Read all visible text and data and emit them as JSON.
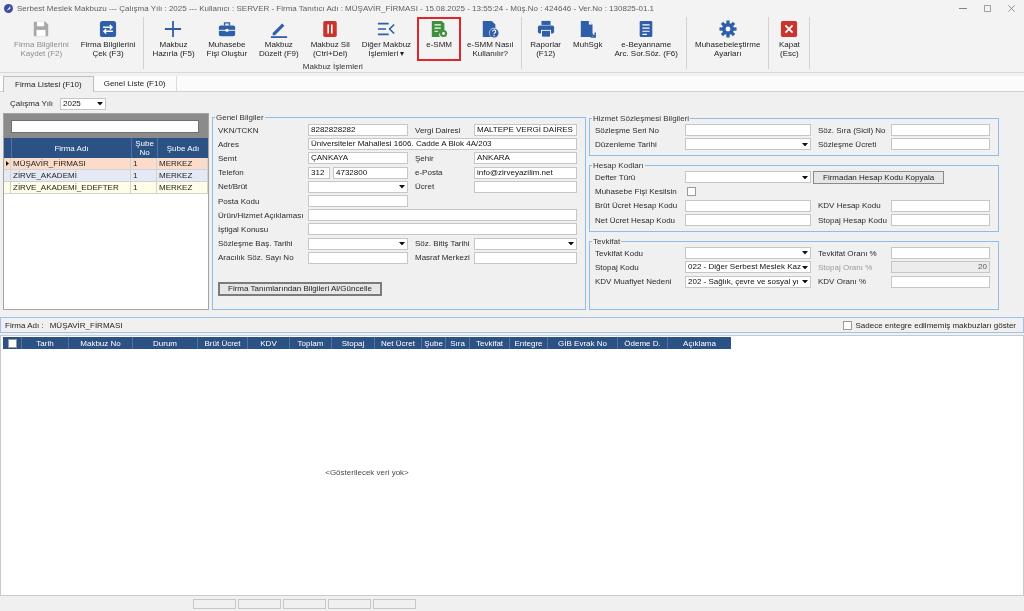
{
  "window": {
    "title": "Serbest Meslek Makbuzu --- Çalışma Yılı : 2025 --- Kullanıcı : SERVER - Firma Tanıtıcı Adı : MÜŞAVİR_FİRMASI - 15.08.2025 - 13:55:24 - Müş.No : 424646 - Ver.No : 130825-01.1"
  },
  "toolbar": {
    "groups": [
      {
        "buttons": [
          {
            "label": "Firma Bilgilerini\nKaydet (F2)",
            "disabled": true,
            "highlighted": false
          },
          {
            "label": "Firma Bilgilerini\nÇek (F3)",
            "disabled": false,
            "highlighted": false
          }
        ]
      },
      {
        "label": "Makbuz İşlemleri",
        "buttons": [
          {
            "label": "Makbuz\nHazırla (F5)",
            "disabled": false,
            "highlighted": false
          },
          {
            "label": "Muhasebe\nFişi Oluştur",
            "disabled": false,
            "highlighted": false
          },
          {
            "label": "Makbuz\nDüzelt (F9)",
            "disabled": false,
            "highlighted": false
          },
          {
            "label": "Makbuz Sil\n(Ctrl+Del)",
            "disabled": false,
            "highlighted": false
          },
          {
            "label": "Diğer Makbuz\nİşlemleri ▾",
            "disabled": false,
            "highlighted": false
          },
          {
            "label": "e-SMM",
            "disabled": false,
            "highlighted": true
          },
          {
            "label": "e-SMM Nasıl\nKullanılır?",
            "disabled": false,
            "highlighted": false
          }
        ]
      },
      {
        "buttons": [
          {
            "label": "Raporlar\n(F12)",
            "disabled": false,
            "highlighted": false
          },
          {
            "label": "MuhSgk",
            "disabled": false,
            "highlighted": false
          },
          {
            "label": "e-Beyanname\nArc. Sor.Söz. (F6)",
            "disabled": false,
            "highlighted": false
          }
        ]
      },
      {
        "buttons": [
          {
            "label": "Muhasebeleştirme\nAyarları",
            "disabled": false,
            "highlighted": false
          }
        ]
      },
      {
        "buttons": [
          {
            "label": "Kapat\n(Esc)",
            "disabled": false,
            "highlighted": false
          }
        ]
      }
    ]
  },
  "tabs": [
    {
      "label": "Firma Listesi (F10)",
      "selected": true
    },
    {
      "label": "Genel Liste (F10)",
      "selected": false
    }
  ],
  "year_filter": {
    "label": "Çalışma Yılı",
    "value": "2025"
  },
  "firm_list": {
    "columns": [
      "Firma Adı",
      "Şube\nNo",
      "Şube Adı"
    ],
    "rows": [
      {
        "cells": [
          "MÜŞAVİR_FİRMASI",
          "1",
          "MERKEZ"
        ],
        "selected": true,
        "color": "#fbdccb"
      },
      {
        "cells": [
          "ZİRVE_AKADEMİ",
          "1",
          "MERKEZ"
        ],
        "selected": false,
        "color": "#e4e9f5"
      },
      {
        "cells": [
          "ZİRVE_AKADEMİ_EDEFTER",
          "1",
          "MERKEZ"
        ],
        "selected": false,
        "color": "#fefde6"
      }
    ]
  },
  "general_info": {
    "title": "Genel Bilgiler",
    "rows": [
      [
        {
          "label": "VKN/TCKN",
          "kind": "text",
          "value": "8282828282"
        },
        {
          "label": "Vergi Dairesi",
          "kind": "text",
          "value": "MALTEPE VERGİ DAİRES"
        }
      ],
      [
        {
          "label": "Adres",
          "kind": "wide",
          "value": "Üniversiteler Mahallesi 1606. Cadde A Blok 4A/203"
        }
      ],
      [
        {
          "label": "Semt",
          "kind": "text",
          "value": "ÇANKAYA"
        },
        {
          "label": "Şehir",
          "kind": "text",
          "value": "ANKARA"
        }
      ],
      [
        {
          "label": "Telefon",
          "kind": "phone",
          "area_code": "312",
          "value": "4732800"
        },
        {
          "label": "e-Posta",
          "kind": "text",
          "value": "info@zirveyazilim.net"
        }
      ],
      [
        {
          "label": "Net/Brüt",
          "kind": "select"
        },
        {
          "label": "Ücret",
          "kind": "text"
        }
      ],
      [
        {
          "label": "Posta Kodu",
          "kind": "text"
        }
      ],
      [
        {
          "label": "Ürün/Hizmet Açıklaması",
          "kind": "wide"
        }
      ],
      [
        {
          "label": "İştigal Konusu",
          "kind": "wide"
        }
      ],
      [
        {
          "label": "Sözleşme Baş. Tarihi",
          "kind": "select"
        },
        {
          "label": "Söz. Bitiş Tarihi",
          "kind": "select"
        }
      ],
      [
        {
          "label": "Aracılık Söz. Sayı No",
          "kind": "text"
        },
        {
          "label": "Masraf Merkezi",
          "kind": "text"
        }
      ]
    ],
    "button": "Firma Tanımlarından Bilgileri Al/Güncelle"
  },
  "contract": {
    "title": "Hizmet Sözleşmesi Bilgileri",
    "rows": [
      [
        {
          "label": "Sözleşme Seri No",
          "kind": "text"
        },
        {
          "label": "Söz. Sıra (Sicil) No",
          "kind": "text"
        }
      ],
      [
        {
          "label": "Düzenleme Tarihi",
          "kind": "select"
        },
        {
          "label": "Sözleşme Ücreti",
          "kind": "text"
        }
      ]
    ]
  },
  "account_codes": {
    "title": "Hesap Kodları",
    "rows": [
      [
        {
          "label": "Defter Türü",
          "kind": "select"
        },
        {
          "label": "Firmadan Hesap Kodu Kopyala",
          "kind": "button"
        }
      ],
      [
        {
          "label": "Muhasebe Fişi Kesilsin",
          "kind": "checkbox",
          "checked": false
        }
      ],
      [
        {
          "label": "Brüt Ücret Hesap Kodu",
          "kind": "text"
        },
        {
          "label": "KDV Hesap Kodu",
          "kind": "text"
        }
      ],
      [
        {
          "label": "Net Ücret Hesap Kodu",
          "kind": "text"
        },
        {
          "label": "Stopaj Hesap Kodu",
          "kind": "text"
        }
      ]
    ]
  },
  "withholding": {
    "title": "Tevkifat",
    "rows": [
      [
        {
          "label": "Tevkifat Kodu",
          "kind": "select"
        },
        {
          "label": "Tevkifat Oranı %",
          "kind": "text"
        }
      ],
      [
        {
          "label": "Stopaj Kodu",
          "kind": "select",
          "value": "022 - Diğer Serbest Meslek Kaz"
        },
        {
          "label": "Stopaj Oranı %",
          "kind": "readonly",
          "value": "20"
        }
      ],
      [
        {
          "label": "KDV Muafiyet Nedeni",
          "kind": "select",
          "value": "202 - Sağlık, çevre ve sosyal yı"
        },
        {
          "label": "KDV Oranı %",
          "kind": "text"
        }
      ]
    ]
  },
  "firm_bar": {
    "label": "Firma Adı :",
    "value": "MÜŞAVİR_FİRMASI",
    "filter": {
      "label": "Sadece entegre edilmemiş makbuzları göster",
      "checked": false
    }
  },
  "receipts": {
    "select_all_checked": false,
    "columns": [
      "Tarih",
      "Makbuz No",
      "Durum",
      "Brüt Ücret",
      "KDV",
      "Toplam",
      "Stopaj",
      "Net Ücret",
      "Şube",
      "Sıra",
      "Tevkifat",
      "Entegre",
      "GİB Evrak No",
      "Ödeme D.",
      "Açıklama"
    ],
    "empty_text": "<Gösterilecek veri yok>"
  }
}
